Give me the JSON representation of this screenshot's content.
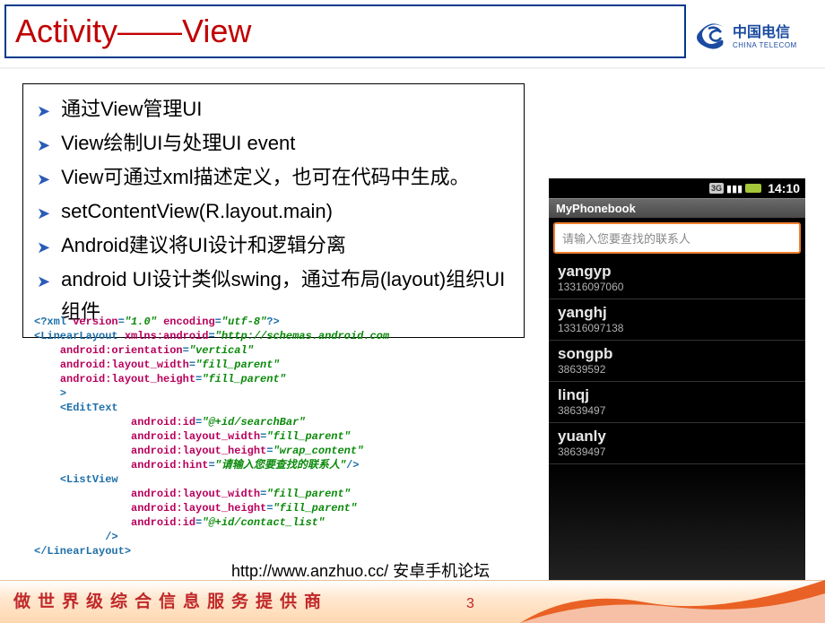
{
  "title": "Activity——View",
  "logo": {
    "cn": "中国电信",
    "en": "CHINA TELECOM"
  },
  "bullets": [
    "通过View管理UI",
    "View绘制UI与处理UI event",
    "View可通过xml描述定义，也可在代码中生成。",
    "setContentView(R.layout.main)",
    "Android建议将UI设计和逻辑分离",
    "android UI设计类似swing，通过布局(layout)组织UI组件"
  ],
  "code": {
    "xml_decl_version": "\"1.0\"",
    "xml_decl_encoding": "\"utf-8\"",
    "xmlns": "\"http://schemas.android.com",
    "orientation": "\"vertical\"",
    "fill_parent": "\"fill_parent\"",
    "wrap_content": "\"wrap_content\"",
    "searchBar_id": "\"@+id/searchBar\"",
    "hint": "\"请输入您要查找的联系人\"",
    "contact_list_id": "\"@+id/contact_list\""
  },
  "footer": {
    "url": "http://www.anzhuo.cc/ 安卓手机论坛",
    "slogan": "做世界级综合信息服务提供商",
    "page": "3"
  },
  "phone": {
    "time": "14:10",
    "net": "3G",
    "app_title": "MyPhonebook",
    "search_placeholder": "请输入您要查找的联系人",
    "contacts": [
      {
        "name": "yangyp",
        "num": "13316097060"
      },
      {
        "name": "yanghj",
        "num": "13316097138"
      },
      {
        "name": "songpb",
        "num": "38639592"
      },
      {
        "name": "linqj",
        "num": "38639497"
      },
      {
        "name": "yuanly",
        "num": "38639497"
      }
    ]
  }
}
